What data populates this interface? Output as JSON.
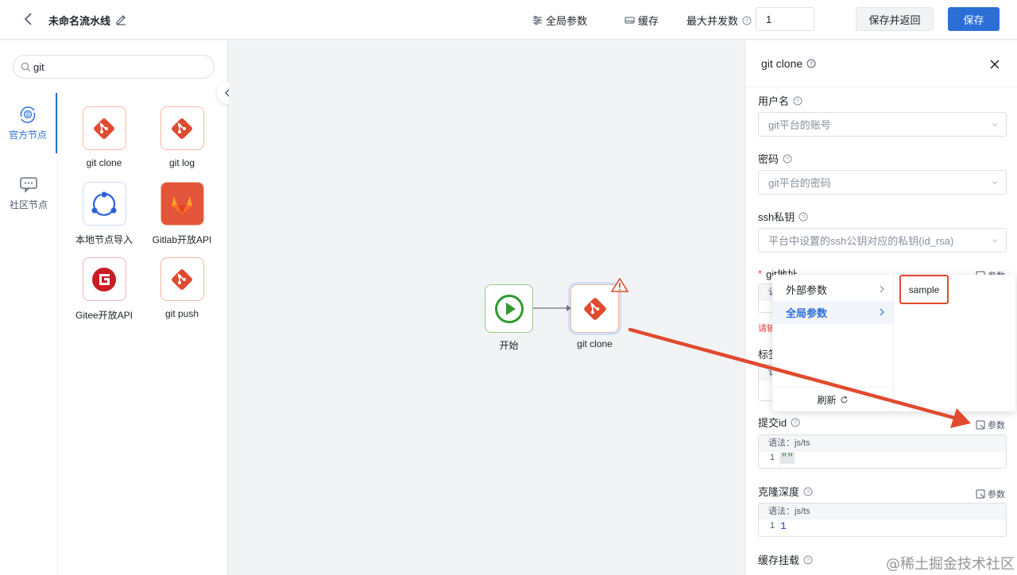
{
  "header": {
    "title": "未命名流水线",
    "global_params": "全局参数",
    "cache": "缓存",
    "max_concurrency_label": "最大并发数",
    "max_concurrency_value": "1",
    "save_and_return": "保存并返回",
    "save": "保存"
  },
  "left_panel": {
    "search_value": "git",
    "categories": [
      {
        "label": "官方节点",
        "icon": "official-nodes-icon",
        "active": true
      },
      {
        "label": "社区节点",
        "icon": "community-nodes-icon",
        "active": false
      }
    ],
    "nodes": [
      {
        "label": "git clone",
        "icon": "git-icon"
      },
      {
        "label": "git log",
        "icon": "git-icon"
      },
      {
        "label": "本地节点导入",
        "icon": "share-nodes-icon"
      },
      {
        "label": "Gitlab开放API",
        "icon": "gitlab-icon"
      },
      {
        "label": "Gitee开放API",
        "icon": "gitee-icon"
      },
      {
        "label": "git push",
        "icon": "git-icon"
      }
    ]
  },
  "canvas": {
    "nodes": [
      {
        "label": "开始",
        "icon": "play-icon"
      },
      {
        "label": "git clone",
        "icon": "git-icon",
        "warning": true
      }
    ]
  },
  "right_panel": {
    "title": "git clone",
    "fields": {
      "username": {
        "label": "用户名",
        "placeholder": "git平台的账号"
      },
      "password": {
        "label": "密码",
        "placeholder": "git平台的密码"
      },
      "ssh_key": {
        "label": "ssh私钥",
        "placeholder": "平台中设置的ssh公钥对应的私钥(id_rsa)"
      },
      "git_url": {
        "label": "git地址",
        "required": true,
        "syntax_partial": "语",
        "error_partial": "请输"
      },
      "tag": {
        "label_partial": "标签",
        "syntax_partial": "语"
      },
      "commit_id": {
        "label": "提交id",
        "syntax": "语法：js/ts",
        "line": "1",
        "code": "\"\""
      },
      "clone_depth": {
        "label": "克隆深度",
        "syntax": "语法：js/ts",
        "line": "1",
        "code": "1"
      },
      "cache_mount": {
        "label": "缓存挂载"
      }
    },
    "param_label": "参数"
  },
  "cascader": {
    "items": [
      "外部参数",
      "全局参数"
    ],
    "active_index": 1,
    "refresh": "刷新",
    "option": "sample"
  },
  "colors": {
    "primary": "#2b6fd6",
    "git_orange": "#e04a2f",
    "start_green": "#2f9b2f",
    "annotation_red": "#e04a2f"
  },
  "watermark": "@稀土掘金技术社区"
}
